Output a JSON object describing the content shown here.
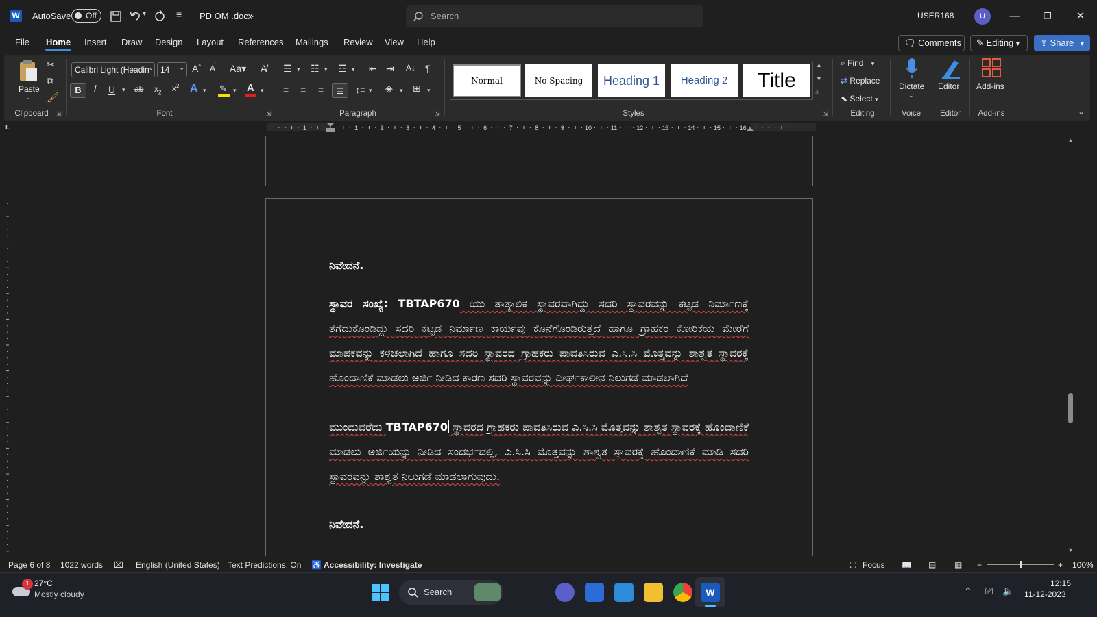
{
  "titlebar": {
    "autosave_label": "AutoSave",
    "autosave_state": "Off",
    "doc_title": "PD OM .docx",
    "search_placeholder": "Search",
    "user_name": "USER168",
    "user_initial": "U"
  },
  "tabs": [
    "File",
    "Home",
    "Insert",
    "Draw",
    "Design",
    "Layout",
    "References",
    "Mailings",
    "Review",
    "View",
    "Help"
  ],
  "active_tab": "Home",
  "top_right": {
    "comments": "Comments",
    "editing": "Editing",
    "share": "Share"
  },
  "ribbon": {
    "clipboard": {
      "paste": "Paste",
      "label": "Clipboard"
    },
    "font": {
      "name": "Calibri Light (Headin",
      "size": "14",
      "label": "Font"
    },
    "paragraph": {
      "label": "Paragraph"
    },
    "styles": {
      "items": [
        "Normal",
        "No Spacing",
        "Heading 1",
        "Heading 2",
        "Title"
      ],
      "label": "Styles"
    },
    "editing": {
      "find": "Find",
      "replace": "Replace",
      "select": "Select",
      "label": "Editing"
    },
    "voice": {
      "dictate": "Dictate",
      "label": "Voice"
    },
    "editor": {
      "editor": "Editor",
      "label": "Editor"
    },
    "addins": {
      "addins": "Add-ins",
      "label": "Add-ins"
    }
  },
  "ruler_numbers": [
    "1",
    "1",
    "2",
    "3",
    "4",
    "5",
    "6",
    "7",
    "8",
    "9",
    "10",
    "11",
    "12",
    "13",
    "14",
    "15",
    "16"
  ],
  "document": {
    "heading1": "ನಿವೇದನೆ.",
    "para1_bold": "ಸ್ಥಾವರ ಸಂಖ್ಯೆ: TBTAP670",
    "para1_rest": " ಯು ತಾತ್ಕಾಲಿಕ ಸ್ಥಾವರವಾಗಿದ್ದು ಸದರಿ ಸ್ಥಾವರವನ್ನು ಕಟ್ಟಡ ನಿರ್ಮಾಣಕ್ಕೆ ತೆಗೆದುಕೊಂಡಿದ್ದು ಸದರಿ ಕಟ್ಟಡ ನಿರ್ಮಾಣ ಕಾರ್ಯವು ಕೊನೆಗೊಂಡಿರುತ್ತದೆ ಹಾಗೂ ಗ್ರಾಹಕರ ಕೋರಿಕೆಯ ಮೇರೆಗೆ ಮಾಪಕವನ್ನು ಕಳಚಲಾಗಿದೆ ಹಾಗೂ ಸದರಿ ಸ್ಥಾವರದ ಗ್ರಾಹಕರು ಪಾವತಿಸಿರುವ ಎ.ಸಿ.ಸಿ ಮೊತ್ತವನ್ನು ಶಾಶ್ವತ ಸ್ಥಾವರಕ್ಕೆ ಹೊಂದಾಣಿಕೆ ಮಾಡಲು ಅರ್ಜಿ ನೀಡಿದ ಕಾರಣ ಸದರಿ ಸ್ಥಾವರವನ್ನು ದೀರ್ಘಕಾಲೀನ ನಿಲುಗಡೆ ಮಾಡಲಾಗಿದೆ",
    "para2_start": "ಮುಂದುವರೆದು ",
    "para2_bold": "TBTAP670",
    "para2_rest": " ಸ್ಥಾವರದ ಗ್ರಾಹಕರು ಪಾವತಿಸಿರುವ ಎ.ಸಿ.ಸಿ ಮೊತ್ತವನ್ನು ಶಾಶ್ವತ ಸ್ಥಾವರಕ್ಕೆ ಹೊಂದಾಣಿಕೆ ಮಾಡಲು ಅರ್ಜಿಯನ್ನು ನೀಡಿದ ಸಂದರ್ಭದಲ್ಲಿ, ಎ.ಸಿ.ಸಿ ಮೊತ್ತವನ್ನು ಶಾಶ್ವತ ಸ್ಥಾವರಕ್ಕೆ ಹೊಂದಾಣಿಕೆ ಮಾಡಿ ಸದರಿ ಸ್ಥಾವರವನ್ನು ಶಾಶ್ವತ ನಿಲುಗಡೆ ಮಾಡಲಾಗುವುದು.",
    "heading2": "ನಿವೇದನೆ."
  },
  "statusbar": {
    "page": "Page 6 of 8",
    "words": "1022 words",
    "language": "English (United States)",
    "predictions": "Text Predictions: On",
    "accessibility": "Accessibility: Investigate",
    "focus": "Focus",
    "zoom": "100%",
    "zoom_level": 0.5
  },
  "taskbar": {
    "temp": "27°C",
    "weather": "Mostly cloudy",
    "weather_badge": "1",
    "search": "Search",
    "time": "12:15",
    "date": "11-12-2023"
  }
}
